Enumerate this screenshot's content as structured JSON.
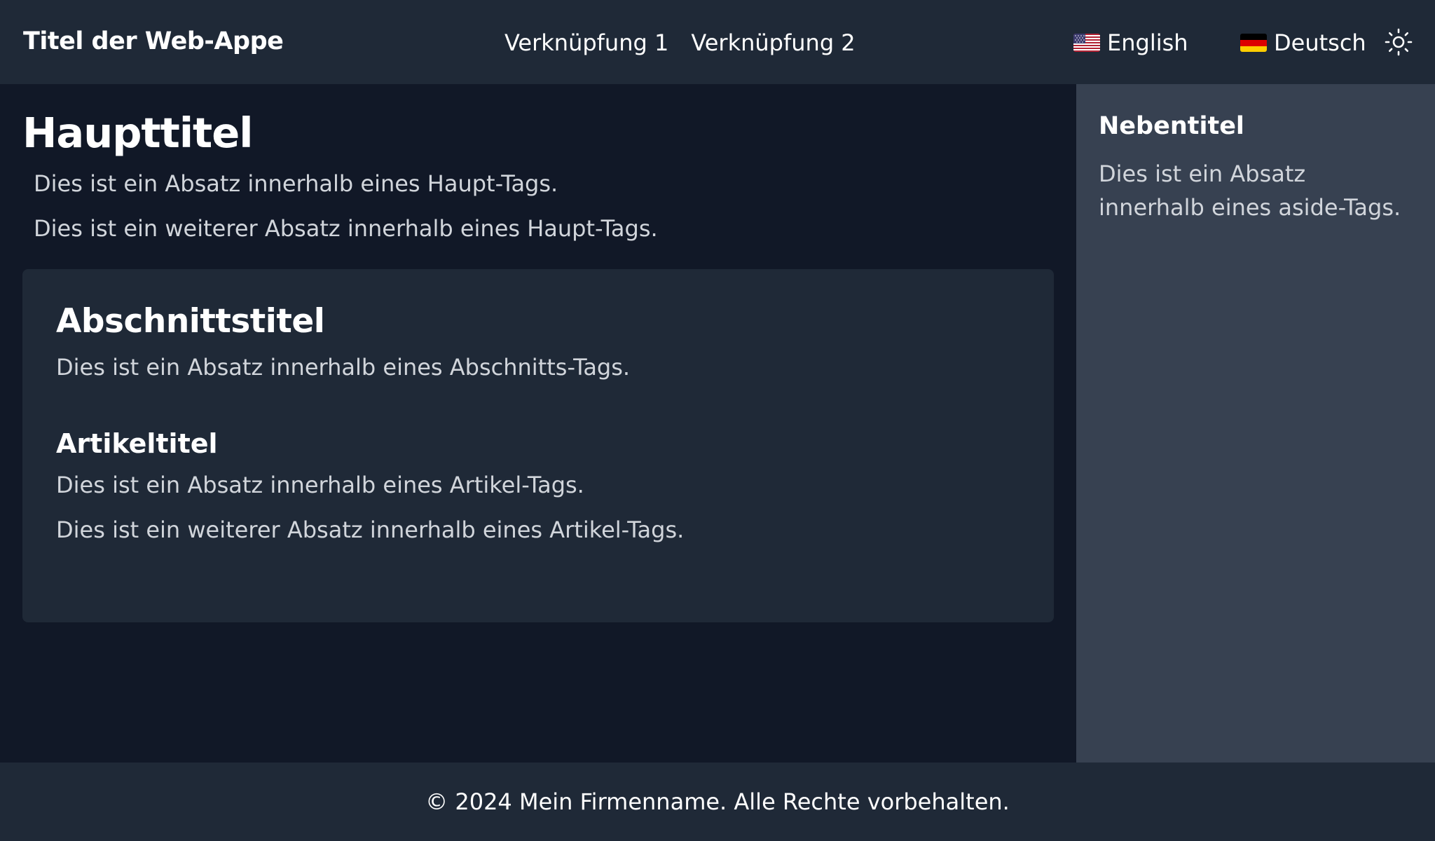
{
  "header": {
    "app_title": "Titel der Web-Appe",
    "nav_links": [
      "Verknüpfung 1",
      "Verknüpfung 2"
    ],
    "languages": [
      {
        "label": "English",
        "flag_icon": "us-flag-icon"
      },
      {
        "label": "Deutsch",
        "flag_icon": "de-flag-icon"
      }
    ],
    "theme_toggle_icon": "sun-icon"
  },
  "main": {
    "title": "Haupttitel",
    "paragraphs": [
      "Dies ist ein Absatz innerhalb eines Haupt-Tags.",
      "Dies ist ein weiterer Absatz innerhalb eines Haupt-Tags."
    ],
    "section": {
      "title": "Abschnittstitel",
      "paragraph": "Dies ist ein Absatz innerhalb eines Abschnitts-Tags.",
      "article": {
        "title": "Artikeltitel",
        "paragraphs": [
          "Dies ist ein Absatz innerhalb eines Artikel-Tags.",
          "Dies ist ein weiterer Absatz innerhalb eines Artikel-Tags."
        ]
      }
    }
  },
  "aside": {
    "title": "Nebentitel",
    "paragraph": "Dies ist ein Absatz innerhalb eines aside-Tags."
  },
  "footer": {
    "text": "© 2024 Mein Firmenname. Alle Rechte vorbehalten."
  },
  "colors": {
    "header_bg": "#1f2937",
    "main_bg": "#111827",
    "card_bg": "#1f2937",
    "aside_bg": "#374151",
    "text": "#ffffff",
    "muted_text": "#d1d5db"
  }
}
